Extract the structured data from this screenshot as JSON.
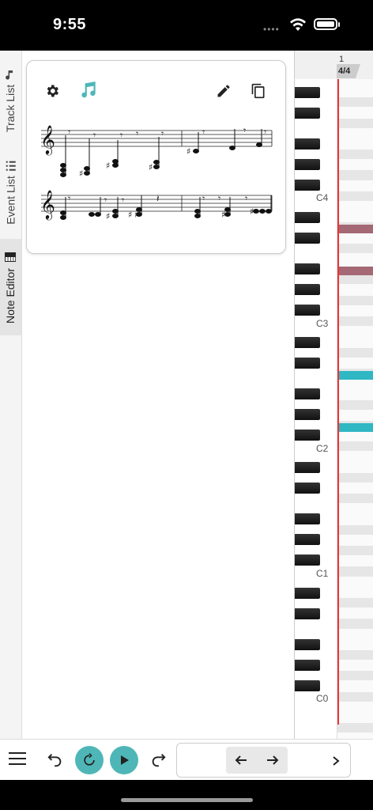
{
  "status": {
    "time": "9:55"
  },
  "sidebar": {
    "tabs": [
      {
        "label": "Track List",
        "icon": "music-note-icon"
      },
      {
        "label": "Event List",
        "icon": "list-icon"
      },
      {
        "label": "Note Editor",
        "icon": "piano-icon",
        "active": true
      }
    ]
  },
  "card": {
    "icons": [
      "gear-icon",
      "music-notes-icon",
      "pencil-icon",
      "copy-icon"
    ],
    "accent": "#4fb6b7"
  },
  "piano_roll": {
    "bar_number": "1",
    "time_signature": "4/4",
    "octave_labels": [
      "C4",
      "C3",
      "C2",
      "C1",
      "C0"
    ],
    "playhead_color": "#e33333",
    "note_colors": [
      "#a56875",
      "#2fb7c4"
    ]
  },
  "toolbar": {
    "icons": [
      "menu-icon",
      "undo-icon",
      "loop-icon",
      "play-icon",
      "redo-icon",
      "arrow-left-icon",
      "arrow-right-icon",
      "chevron-right-icon"
    ],
    "accent": "#4fb6b7"
  }
}
